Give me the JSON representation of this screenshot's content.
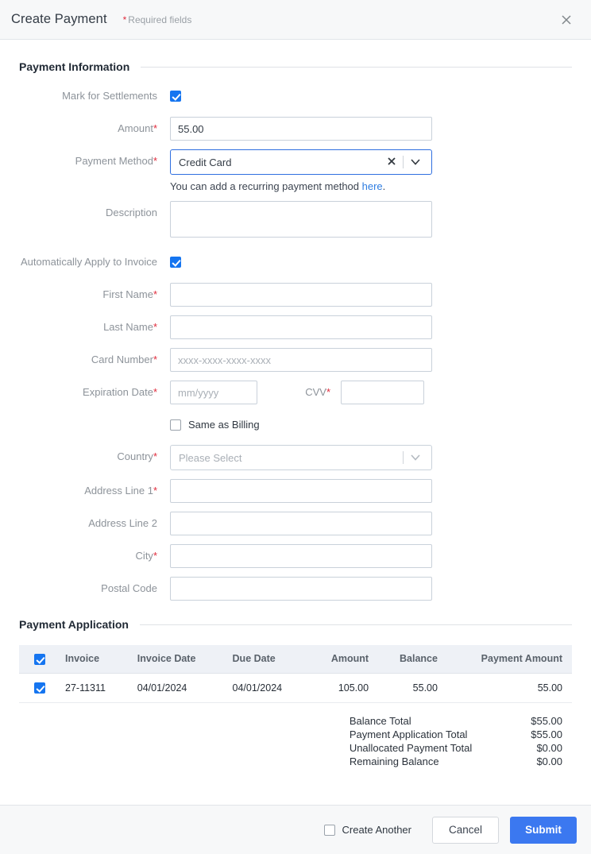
{
  "header": {
    "title": "Create Payment",
    "required_note": "Required fields",
    "required_star": "*",
    "close_icon": "close-icon"
  },
  "sections": {
    "payment_information": "Payment Information",
    "payment_application": "Payment Application"
  },
  "form": {
    "mark_for_settlements": {
      "label": "Mark for Settlements",
      "checked": true
    },
    "amount": {
      "label": "Amount",
      "required": "*",
      "value": "55.00"
    },
    "payment_method": {
      "label": "Payment Method",
      "required": "*",
      "value": "Credit Card",
      "clear_icon": "clear-x-icon",
      "caret_icon": "chevron-down-icon"
    },
    "recurring_hint": {
      "text": "You can add a recurring payment method ",
      "link": "here",
      "suffix": "."
    },
    "description": {
      "label": "Description",
      "value": ""
    },
    "auto_apply": {
      "label": "Automatically Apply to Invoice",
      "checked": true
    },
    "first_name": {
      "label": "First Name",
      "required": "*",
      "value": ""
    },
    "last_name": {
      "label": "Last Name",
      "required": "*",
      "value": ""
    },
    "card_number": {
      "label": "Card Number",
      "required": "*",
      "placeholder": "xxxx-xxxx-xxxx-xxxx",
      "value": ""
    },
    "expiration_date": {
      "label": "Expiration Date",
      "required": "*",
      "placeholder": "mm/yyyy",
      "value": ""
    },
    "cvv": {
      "label": "CVV",
      "required": "*",
      "value": ""
    },
    "same_as_billing": {
      "label": "Same as Billing",
      "checked": false
    },
    "country": {
      "label": "Country",
      "required": "*",
      "value": "Please Select",
      "caret_icon": "chevron-down-icon"
    },
    "address_line_1": {
      "label": "Address Line 1",
      "required": "*",
      "value": ""
    },
    "address_line_2": {
      "label": "Address Line 2",
      "value": ""
    },
    "city": {
      "label": "City",
      "required": "*",
      "value": ""
    },
    "postal_code": {
      "label": "Postal Code",
      "value": ""
    }
  },
  "table": {
    "select_all_checked": true,
    "columns": [
      "Invoice",
      "Invoice Date",
      "Due Date",
      "Amount",
      "Balance",
      "Payment Amount"
    ],
    "rows": [
      {
        "checked": true,
        "invoice": "27-11311",
        "invoice_date": "04/01/2024",
        "due_date": "04/01/2024",
        "amount": "105.00",
        "balance": "55.00",
        "payment_amount": "55.00"
      }
    ]
  },
  "totals": [
    {
      "label": "Balance Total",
      "value": "$55.00"
    },
    {
      "label": "Payment Application Total",
      "value": "$55.00"
    },
    {
      "label": "Unallocated Payment Total",
      "value": "$0.00"
    },
    {
      "label": "Remaining Balance",
      "value": "$0.00"
    }
  ],
  "footer": {
    "create_another": {
      "label": "Create Another",
      "checked": false
    },
    "cancel": "Cancel",
    "submit": "Submit"
  },
  "colors": {
    "accent_blue": "#3b78f0",
    "checkbox_blue": "#1575f0",
    "required_red": "#e02b3c",
    "link_blue": "#2f7de1",
    "table_header_bg": "#eef1f6"
  }
}
